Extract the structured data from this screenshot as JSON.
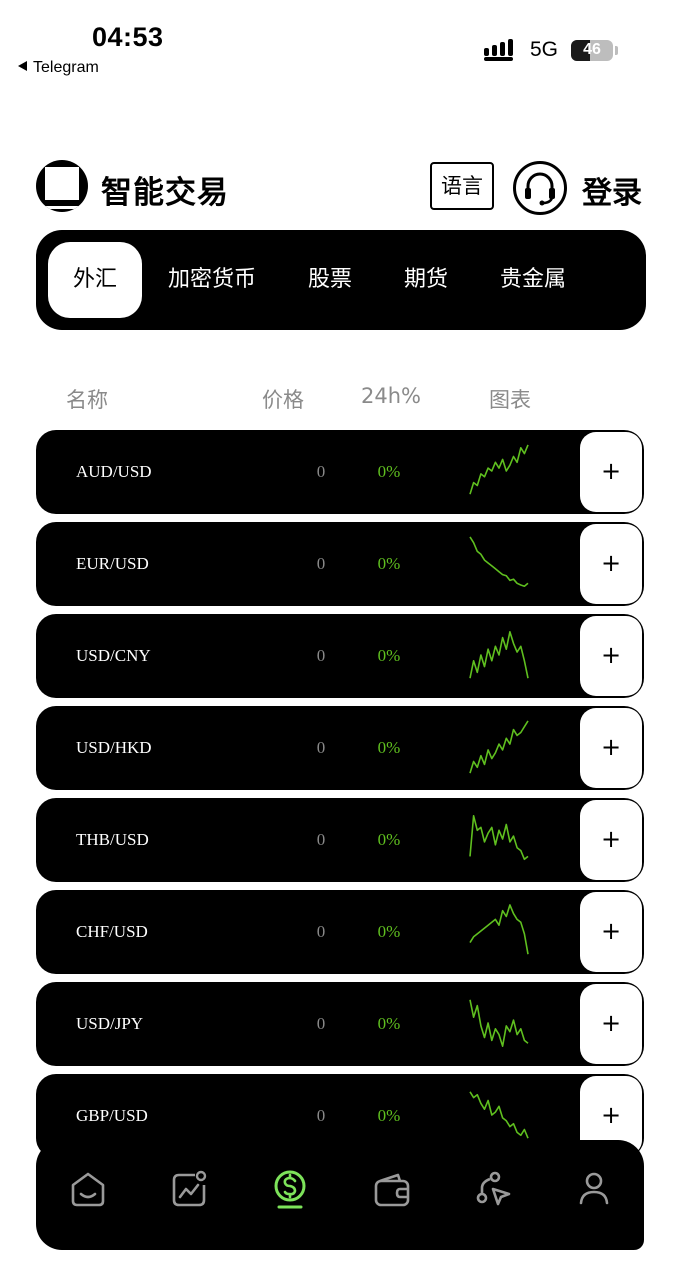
{
  "status_bar": {
    "time": "04:53",
    "back_app": "Telegram",
    "network": "5G",
    "battery": "46",
    "battery_level": 0.46
  },
  "header": {
    "title": "智能交易",
    "language_button": "语言",
    "login_button": "登录",
    "logo_icon": "logo-icon",
    "support_icon": "headset-icon"
  },
  "tabs": [
    {
      "label": "外汇",
      "active": true
    },
    {
      "label": "加密货币",
      "active": false
    },
    {
      "label": "股票",
      "active": false
    },
    {
      "label": "期货",
      "active": false
    },
    {
      "label": "贵金属",
      "active": false
    }
  ],
  "columns": {
    "name": "名称",
    "price": "价格",
    "change": "24h%",
    "chart": "图表"
  },
  "colors": {
    "accent_green": "#5fbf1f",
    "background": "#ffffff",
    "card": "#000000"
  },
  "rows": [
    {
      "pair": "AUD/USD",
      "price": "0",
      "change": "0%",
      "add": "+",
      "trend": [
        0.9,
        0.7,
        0.75,
        0.55,
        0.6,
        0.45,
        0.5,
        0.35,
        0.45,
        0.3,
        0.5,
        0.4,
        0.25,
        0.35,
        0.1,
        0.2,
        0.05
      ]
    },
    {
      "pair": "EUR/USD",
      "price": "0",
      "change": "0%",
      "add": "+",
      "trend": [
        0.05,
        0.15,
        0.3,
        0.35,
        0.45,
        0.5,
        0.55,
        0.6,
        0.65,
        0.7,
        0.72,
        0.8,
        0.78,
        0.85,
        0.88,
        0.9,
        0.85
      ]
    },
    {
      "pair": "USD/CNY",
      "price": "0",
      "change": "0%",
      "add": "+",
      "trend": [
        0.9,
        0.6,
        0.8,
        0.5,
        0.7,
        0.4,
        0.6,
        0.35,
        0.5,
        0.2,
        0.4,
        0.1,
        0.3,
        0.45,
        0.35,
        0.6,
        0.9
      ]
    },
    {
      "pair": "USD/HKD",
      "price": "0",
      "change": "0%",
      "add": "+",
      "trend": [
        0.95,
        0.75,
        0.85,
        0.65,
        0.8,
        0.55,
        0.7,
        0.6,
        0.45,
        0.55,
        0.35,
        0.45,
        0.2,
        0.3,
        0.25,
        0.15,
        0.05
      ]
    },
    {
      "pair": "THB/USD",
      "price": "0",
      "change": "0%",
      "add": "+",
      "trend": [
        0.8,
        0.1,
        0.35,
        0.3,
        0.55,
        0.4,
        0.3,
        0.6,
        0.35,
        0.5,
        0.25,
        0.55,
        0.45,
        0.65,
        0.7,
        0.85,
        0.8
      ]
    },
    {
      "pair": "CHF/USD",
      "price": "0",
      "change": "0%",
      "add": "+",
      "trend": [
        0.7,
        0.6,
        0.55,
        0.5,
        0.45,
        0.4,
        0.35,
        0.3,
        0.4,
        0.15,
        0.25,
        0.05,
        0.2,
        0.3,
        0.35,
        0.55,
        0.9
      ]
    },
    {
      "pair": "USD/JPY",
      "price": "0",
      "change": "0%",
      "add": "+",
      "trend": [
        0.1,
        0.4,
        0.2,
        0.55,
        0.75,
        0.5,
        0.8,
        0.6,
        0.7,
        0.9,
        0.55,
        0.65,
        0.45,
        0.7,
        0.6,
        0.8,
        0.85
      ]
    },
    {
      "pair": "GBP/USD",
      "price": "0",
      "change": "0%",
      "add": "+",
      "trend": [
        0.1,
        0.2,
        0.15,
        0.3,
        0.4,
        0.25,
        0.5,
        0.45,
        0.35,
        0.55,
        0.6,
        0.7,
        0.65,
        0.8,
        0.85,
        0.75,
        0.9
      ]
    }
  ],
  "bottom_nav": [
    {
      "icon": "home-icon",
      "active": false
    },
    {
      "icon": "market-chart-icon",
      "active": false
    },
    {
      "icon": "trade-dollar-icon",
      "active": true
    },
    {
      "icon": "wallet-icon",
      "active": false
    },
    {
      "icon": "share-icon",
      "active": false
    },
    {
      "icon": "profile-icon",
      "active": false
    }
  ]
}
